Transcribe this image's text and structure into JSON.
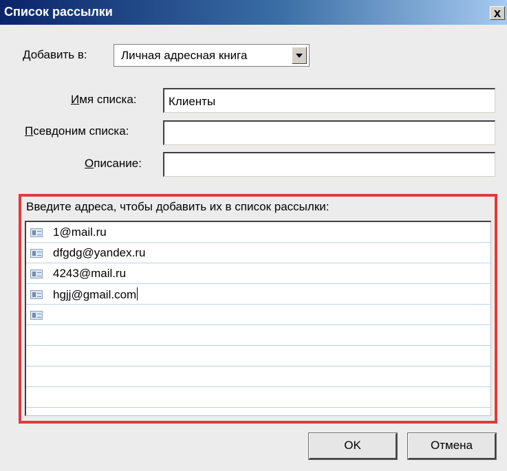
{
  "window": {
    "title": "Список рассылки",
    "close_label": "x"
  },
  "add_to": {
    "label_accel": "Д",
    "label_rest": "обавить в:",
    "selected_value": "Личная адресная книга"
  },
  "fields": {
    "list_name": {
      "label_accel": "И",
      "label_rest": "мя списка:",
      "value": "Клиенты"
    },
    "alias": {
      "label_accel": "П",
      "label_rest": "севдоним списка:",
      "value": ""
    },
    "description": {
      "label_accel": "О",
      "label_rest": "писание:",
      "value": ""
    }
  },
  "addresses": {
    "prompt": "Введите адреса, чтобы добавить их в список рассылки:",
    "entries": [
      "1@mail.ru",
      "dfgdg@yandex.ru",
      "4243@mail.ru",
      "hgjj@gmail.com",
      ""
    ],
    "icon": "contact-card-icon"
  },
  "buttons": {
    "ok": "OK",
    "cancel": "Отмена"
  },
  "colors": {
    "highlight_border": "#e03a3a",
    "title_bar": "#0a246a",
    "row_divider": "#bcd1ea"
  }
}
